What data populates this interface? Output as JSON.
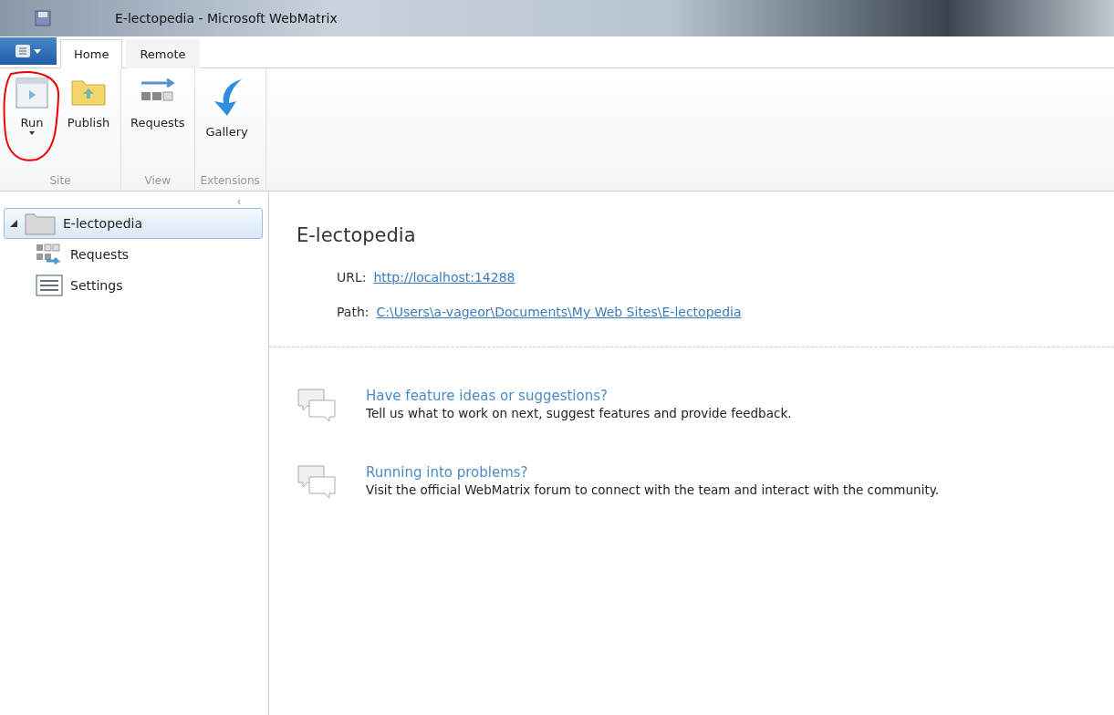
{
  "window": {
    "title": "E-lectopedia - Microsoft WebMatrix"
  },
  "tabs": [
    {
      "label": "Home",
      "selected": true
    },
    {
      "label": "Remote",
      "selected": false
    }
  ],
  "ribbon": {
    "groups": [
      {
        "label": "Site",
        "buttons": [
          {
            "label": "Run",
            "kind": "run",
            "dropdown": true,
            "circled": true
          },
          {
            "label": "Publish",
            "kind": "publish",
            "dropdown": false,
            "circled": false
          }
        ]
      },
      {
        "label": "View",
        "buttons": [
          {
            "label": "Requests",
            "kind": "requests",
            "dropdown": false,
            "circled": false
          }
        ]
      },
      {
        "label": "Extensions",
        "buttons": [
          {
            "label": "Gallery",
            "kind": "gallery",
            "dropdown": false,
            "circled": false
          }
        ]
      }
    ]
  },
  "sidebar": {
    "collapse": "‹",
    "items": [
      {
        "label": "E-lectopedia",
        "kind": "folder",
        "selected": true,
        "expanded": true,
        "children": [
          {
            "label": "Requests",
            "kind": "requests",
            "selected": false
          },
          {
            "label": "Settings",
            "kind": "settings",
            "selected": false
          }
        ]
      }
    ]
  },
  "site": {
    "title": "E-lectopedia",
    "fields": [
      {
        "label": "URL:",
        "link": "http://localhost:14288"
      },
      {
        "label": "Path:",
        "link": "C:\\Users\\a-vageor\\Documents\\My Web Sites\\E-lectopedia"
      }
    ]
  },
  "help": [
    {
      "title": "Have feature ideas or suggestions?",
      "text": "Tell us what to work on next, suggest features and provide feedback."
    },
    {
      "title": "Running into problems?",
      "text": "Visit the official WebMatrix forum to connect with the team and interact with the community."
    }
  ]
}
